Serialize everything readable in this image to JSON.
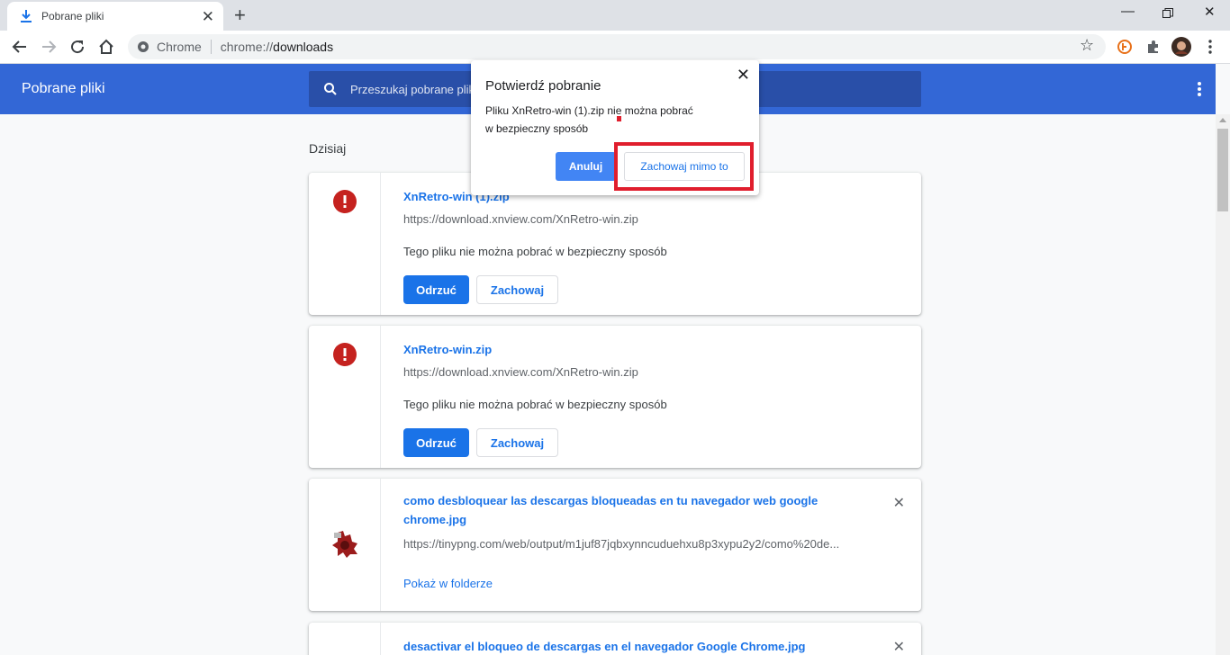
{
  "browser": {
    "tab_title": "Pobrane pliki",
    "omnibox_chip": "Chrome",
    "url_scheme": "chrome://",
    "url_host": "downloads"
  },
  "header": {
    "title": "Pobrane pliki",
    "search_placeholder": "Przeszukaj pobrane pliki"
  },
  "section_label": "Dzisiaj",
  "downloads": [
    {
      "name": "XnRetro-win (1).zip",
      "url": "https://download.xnview.com/XnRetro-win.zip",
      "warning": "Tego pliku nie można pobrać w bezpieczny sposób",
      "discard_label": "Odrzuć",
      "keep_label": "Zachowaj"
    },
    {
      "name": "XnRetro-win.zip",
      "url": "https://download.xnview.com/XnRetro-win.zip",
      "warning": "Tego pliku nie można pobrać w bezpieczny sposób",
      "discard_label": "Odrzuć",
      "keep_label": "Zachowaj"
    },
    {
      "name": "como desbloquear las descargas bloqueadas en tu navegador web google chrome.jpg",
      "url": "https://tinypng.com/web/output/m1juf87jqbxynncuduehxu8p3xypu2y2/como%20de...",
      "show_in_folder": "Pokaż w folderze"
    },
    {
      "name": "desactivar el bloqueo de descargas en el navegador Google Chrome.jpg"
    }
  ],
  "dialog": {
    "title": "Potwierdź pobranie",
    "message_line1": "Pliku XnRetro-win (1).zip nie można pobrać",
    "message_line2": "w bezpieczny sposób",
    "cancel_label": "Anuluj",
    "keep_label": "Zachowaj mimo to"
  },
  "colors": {
    "header_bg": "#3367d6",
    "accent": "#1a73e8",
    "danger": "#c5221f",
    "highlight_box": "#e01e2d"
  }
}
